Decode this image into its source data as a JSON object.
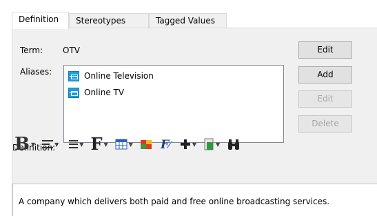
{
  "tabs": [
    {
      "label": "Definition",
      "active": true
    },
    {
      "label": "Stereotypes",
      "active": false
    },
    {
      "label": "Tagged Values",
      "active": false
    }
  ],
  "term": {
    "label": "Term:",
    "value": "OTV"
  },
  "aliases": {
    "label": "Aliases:",
    "items": [
      "Online Television",
      "Online TV"
    ]
  },
  "buttons": {
    "edit_term": "Edit",
    "add": "Add",
    "edit_alias": "Edit",
    "delete": "Delete"
  },
  "definition": {
    "label": "Definition:",
    "text": "A company which delivers both paid and free online broadcasting services."
  },
  "toolbar": {
    "bold_glyph": "B",
    "font_glyph": "F"
  },
  "icons": [
    "alias-icon",
    "bold-icon",
    "align-icon",
    "list-icon",
    "font-icon",
    "table-icon",
    "color-icon",
    "format-icon",
    "insert-icon",
    "paste-icon",
    "find-icon"
  ]
}
